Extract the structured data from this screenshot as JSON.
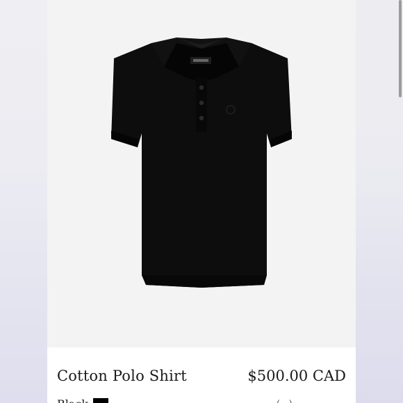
{
  "product": {
    "title": "Cotton Polo Shirt",
    "price": "$500.00 CAD",
    "color_label": "Black",
    "size_hint": "(...)",
    "image_alt": "black polo shirt"
  },
  "colors": {
    "swatch": "#000000",
    "shirt": "#0d0d0d",
    "background": "#f3f3f3"
  }
}
